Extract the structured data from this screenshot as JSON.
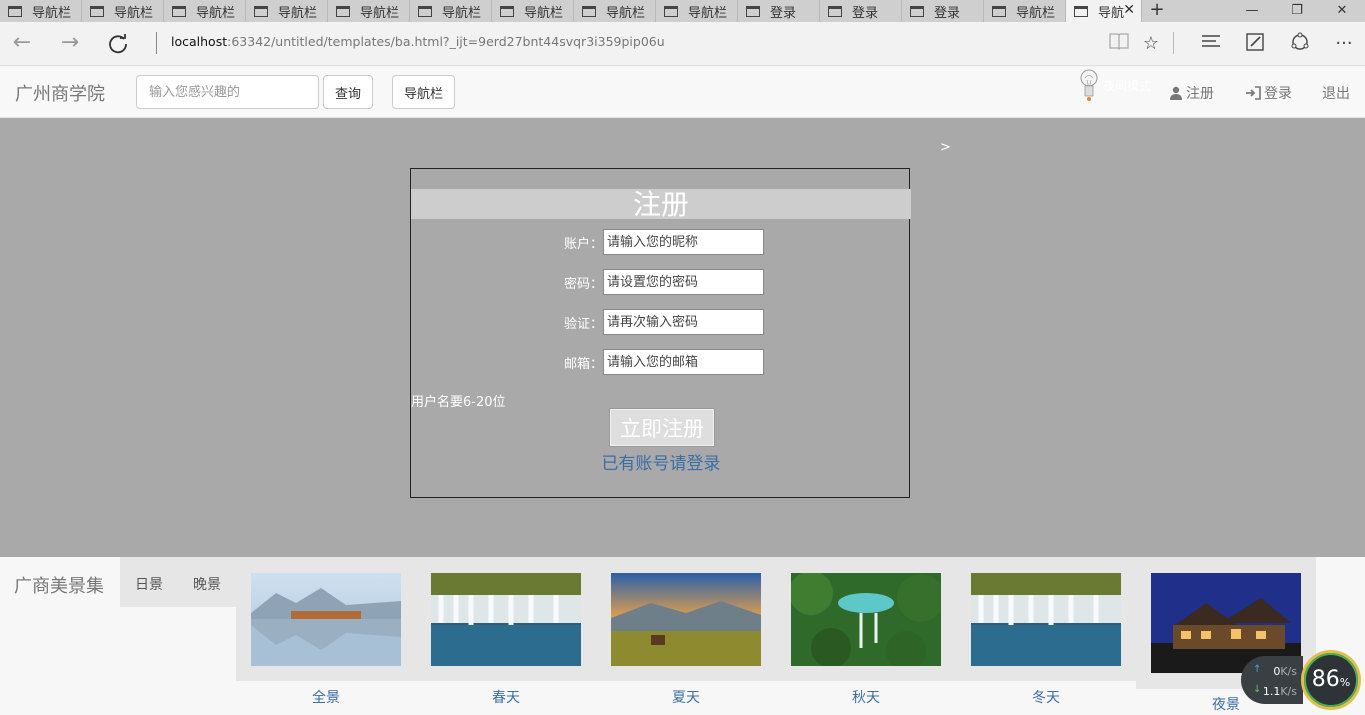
{
  "browser": {
    "tabs": [
      {
        "label": "导航栏"
      },
      {
        "label": "导航栏"
      },
      {
        "label": "导航栏"
      },
      {
        "label": "导航栏"
      },
      {
        "label": "导航栏"
      },
      {
        "label": "导航栏"
      },
      {
        "label": "导航栏"
      },
      {
        "label": "导航栏"
      },
      {
        "label": "导航栏"
      },
      {
        "label": "登录"
      },
      {
        "label": "登录"
      },
      {
        "label": "登录"
      },
      {
        "label": "导航栏"
      }
    ],
    "active_tab": {
      "label": "导航"
    },
    "url_host": "localhost",
    "url_rest": ":63342/untitled/templates/ba.html?_ijt=9erd27bnt44svqr3i359pip06u"
  },
  "navbar": {
    "brand": "广州商学院",
    "search_placeholder": "输入您感兴趣的",
    "search_button": "查询",
    "nav_button": "导航栏",
    "bulb_text": "夜间模式",
    "register": "注册",
    "login": "登录",
    "logout": "退出"
  },
  "main": {
    "stray_text": ">",
    "form": {
      "title": "注册",
      "fields": [
        {
          "label": "账户：",
          "placeholder": "请输入您的昵称"
        },
        {
          "label": "密码：",
          "placeholder": "请设置您的密码"
        },
        {
          "label": "验证：",
          "placeholder": "请再次输入密码"
        },
        {
          "label": "邮箱：",
          "placeholder": "请输入您的邮箱"
        }
      ],
      "hint": "用户名要6-20位",
      "submit": "立即注册",
      "login_link": "已有账号请登录"
    }
  },
  "gallery": {
    "title": "广商美景集",
    "tabs": [
      "日景",
      "晚景"
    ],
    "items": [
      {
        "caption": "全景"
      },
      {
        "caption": "春天"
      },
      {
        "caption": "夏天"
      },
      {
        "caption": "秋天"
      },
      {
        "caption": "冬天"
      },
      {
        "caption": "夜景"
      }
    ]
  },
  "system": {
    "upload": "0",
    "upload_unit": "K/s",
    "download": "1.1",
    "download_unit": "K/s",
    "gauge": "86",
    "gauge_unit": "%"
  },
  "colors": {
    "main_bg": "#a9a9a9",
    "link": "#3a6ea5",
    "title_bar": "#cdcdcd"
  }
}
